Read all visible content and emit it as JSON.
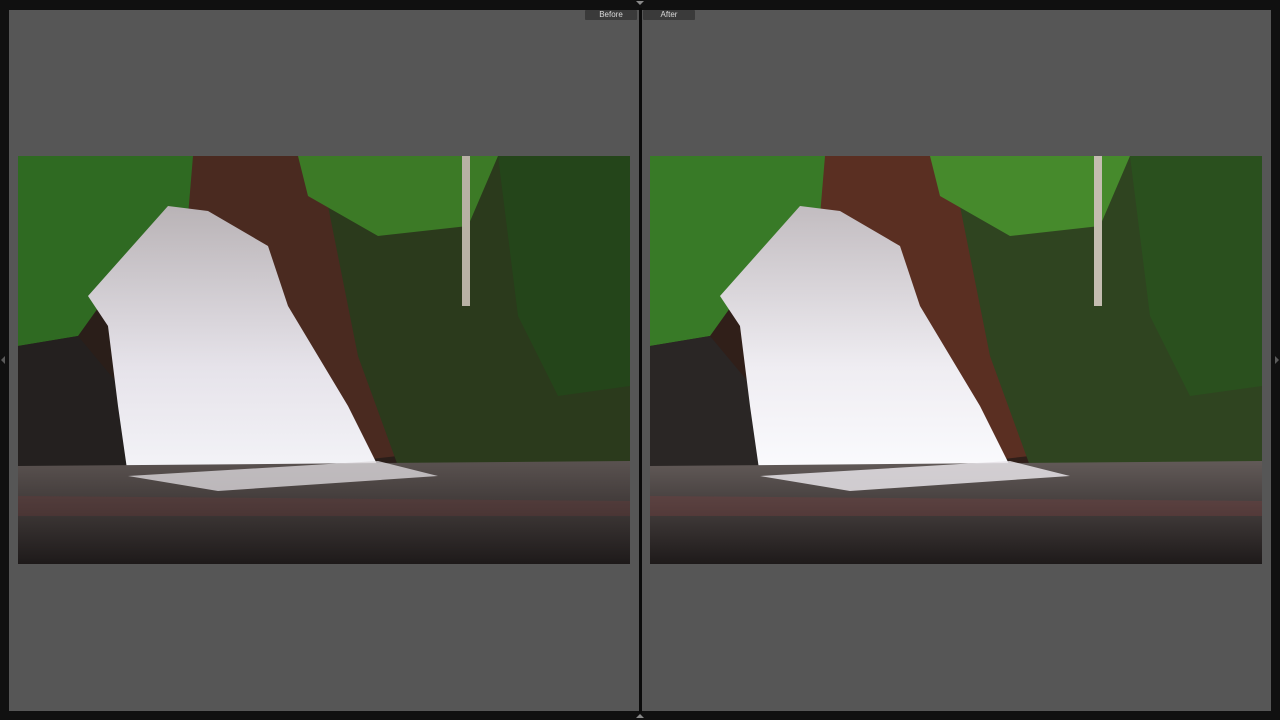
{
  "compare_view": {
    "before_label": "Before",
    "after_label": "After"
  },
  "photo": {
    "subject": "waterfall",
    "before_tone": "#3b2a22",
    "after_tone": "#4a2f25"
  },
  "colors": {
    "pane_background": "#565656",
    "frame_background": "#101010",
    "label_background": "#3a3a3a"
  }
}
